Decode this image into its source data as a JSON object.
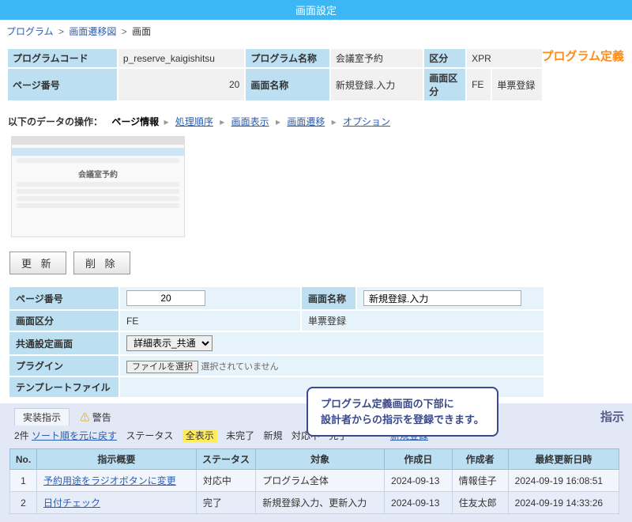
{
  "header": {
    "title": "画面設定"
  },
  "breadcrumb": {
    "items": [
      "プログラム",
      "画面遷移図",
      "画面"
    ]
  },
  "definition": {
    "section_title": "プログラム定義",
    "rows": [
      [
        {
          "label": "プログラムコード",
          "value": "p_reserve_kaigishitsu"
        },
        {
          "label": "プログラム名称",
          "value": "会議室予約"
        },
        {
          "label": "区分",
          "value": "XPR"
        }
      ],
      [
        {
          "label": "ページ番号",
          "value": "20",
          "num": true
        },
        {
          "label": "画面名称",
          "value": "新規登録.入力"
        },
        {
          "label": "画面区分",
          "value": "FE",
          "value2": "単票登録"
        }
      ]
    ]
  },
  "ops": {
    "lead": "以下のデータの操作：",
    "current": "ページ情報",
    "links": [
      "処理順序",
      "画面表示",
      "画面遷移",
      "オプション"
    ]
  },
  "thumb": {
    "title": "会議室予約"
  },
  "buttons": {
    "update": "更 新",
    "delete": "削 除"
  },
  "form2": {
    "page_no_label": "ページ番号",
    "page_no_value": "20",
    "screen_name_label": "画面名称",
    "screen_name_value": "新規登録.入力",
    "screen_kbn_label": "画面区分",
    "screen_kbn_value": "FE",
    "screen_kbn_text": "単票登録",
    "common_label": "共通設定画面",
    "common_value": "詳細表示_共通",
    "plugin_label": "プラグイン",
    "file_btn": "ファイルを選択",
    "file_none": "選択されていません",
    "template_label": "テンプレートファイル"
  },
  "callout": {
    "line1": "プログラム定義画面の下部に",
    "line2": "設計者からの指示を登録できます。"
  },
  "instructions": {
    "section_title": "指示",
    "tabs": {
      "impl": "実装指示",
      "warn": "警告"
    },
    "count": "2件",
    "reset_sort": "ソート順を元に戻す",
    "status_label": "ステータス",
    "filters": [
      "全表示",
      "未完了",
      "新規",
      "対応中",
      "完了"
    ],
    "highlighted": "全表示",
    "new_link": "新規登録",
    "headers": [
      "No.",
      "指示概要",
      "ステータス",
      "対象",
      "作成日",
      "作成者",
      "最終更新日時"
    ],
    "rows": [
      {
        "no": "1",
        "summary": "予約用途をラジオボタンに変更",
        "status": "対応中",
        "target": "プログラム全体",
        "created": "2024-09-13",
        "creator": "情報佳子",
        "updated": "2024-09-19 16:08:51"
      },
      {
        "no": "2",
        "summary": "日付チェック",
        "status": "完了",
        "target": "新規登録入力、更新入力",
        "created": "2024-09-13",
        "creator": "住友太郎",
        "updated": "2024-09-19 14:33:26"
      }
    ]
  }
}
